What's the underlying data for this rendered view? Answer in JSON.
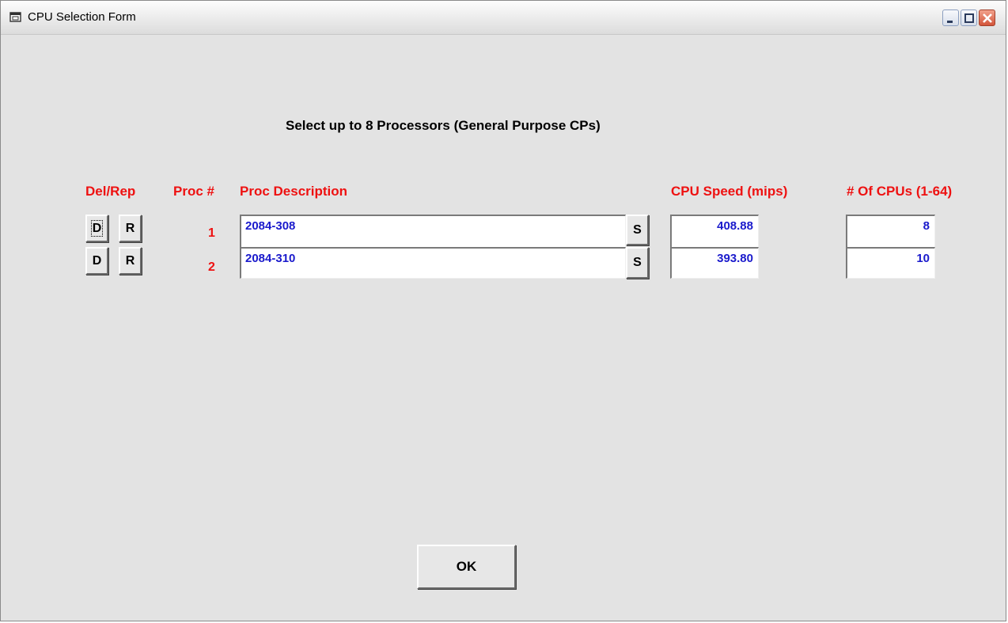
{
  "window": {
    "title": "CPU Selection Form"
  },
  "form": {
    "heading": "Select up to 8 Processors (General Purpose CPs)",
    "columns": {
      "del_rep": "Del/Rep",
      "proc_num": "Proc #",
      "proc_desc": "Proc Description",
      "cpu_speed": "CPU Speed (mips)",
      "num_cpus": "# Of CPUs (1-64)"
    },
    "rows": [
      {
        "del_label": "D",
        "rep_label": "R",
        "proc_num": "1",
        "description": "2084-308",
        "select_label": "S",
        "speed": "408.88",
        "count": "8"
      },
      {
        "del_label": "D",
        "rep_label": "R",
        "proc_num": "2",
        "description": "2084-310",
        "select_label": "S",
        "speed": "393.80",
        "count": "10"
      }
    ],
    "ok_label": "OK"
  },
  "colors": {
    "header_red": "#ee1111",
    "value_blue": "#1a1acc",
    "background": "#e3e3e3"
  },
  "icons": {
    "app": "window-app-icon",
    "minimize": "minimize-icon",
    "maximize": "maximize-icon",
    "close": "close-icon"
  }
}
